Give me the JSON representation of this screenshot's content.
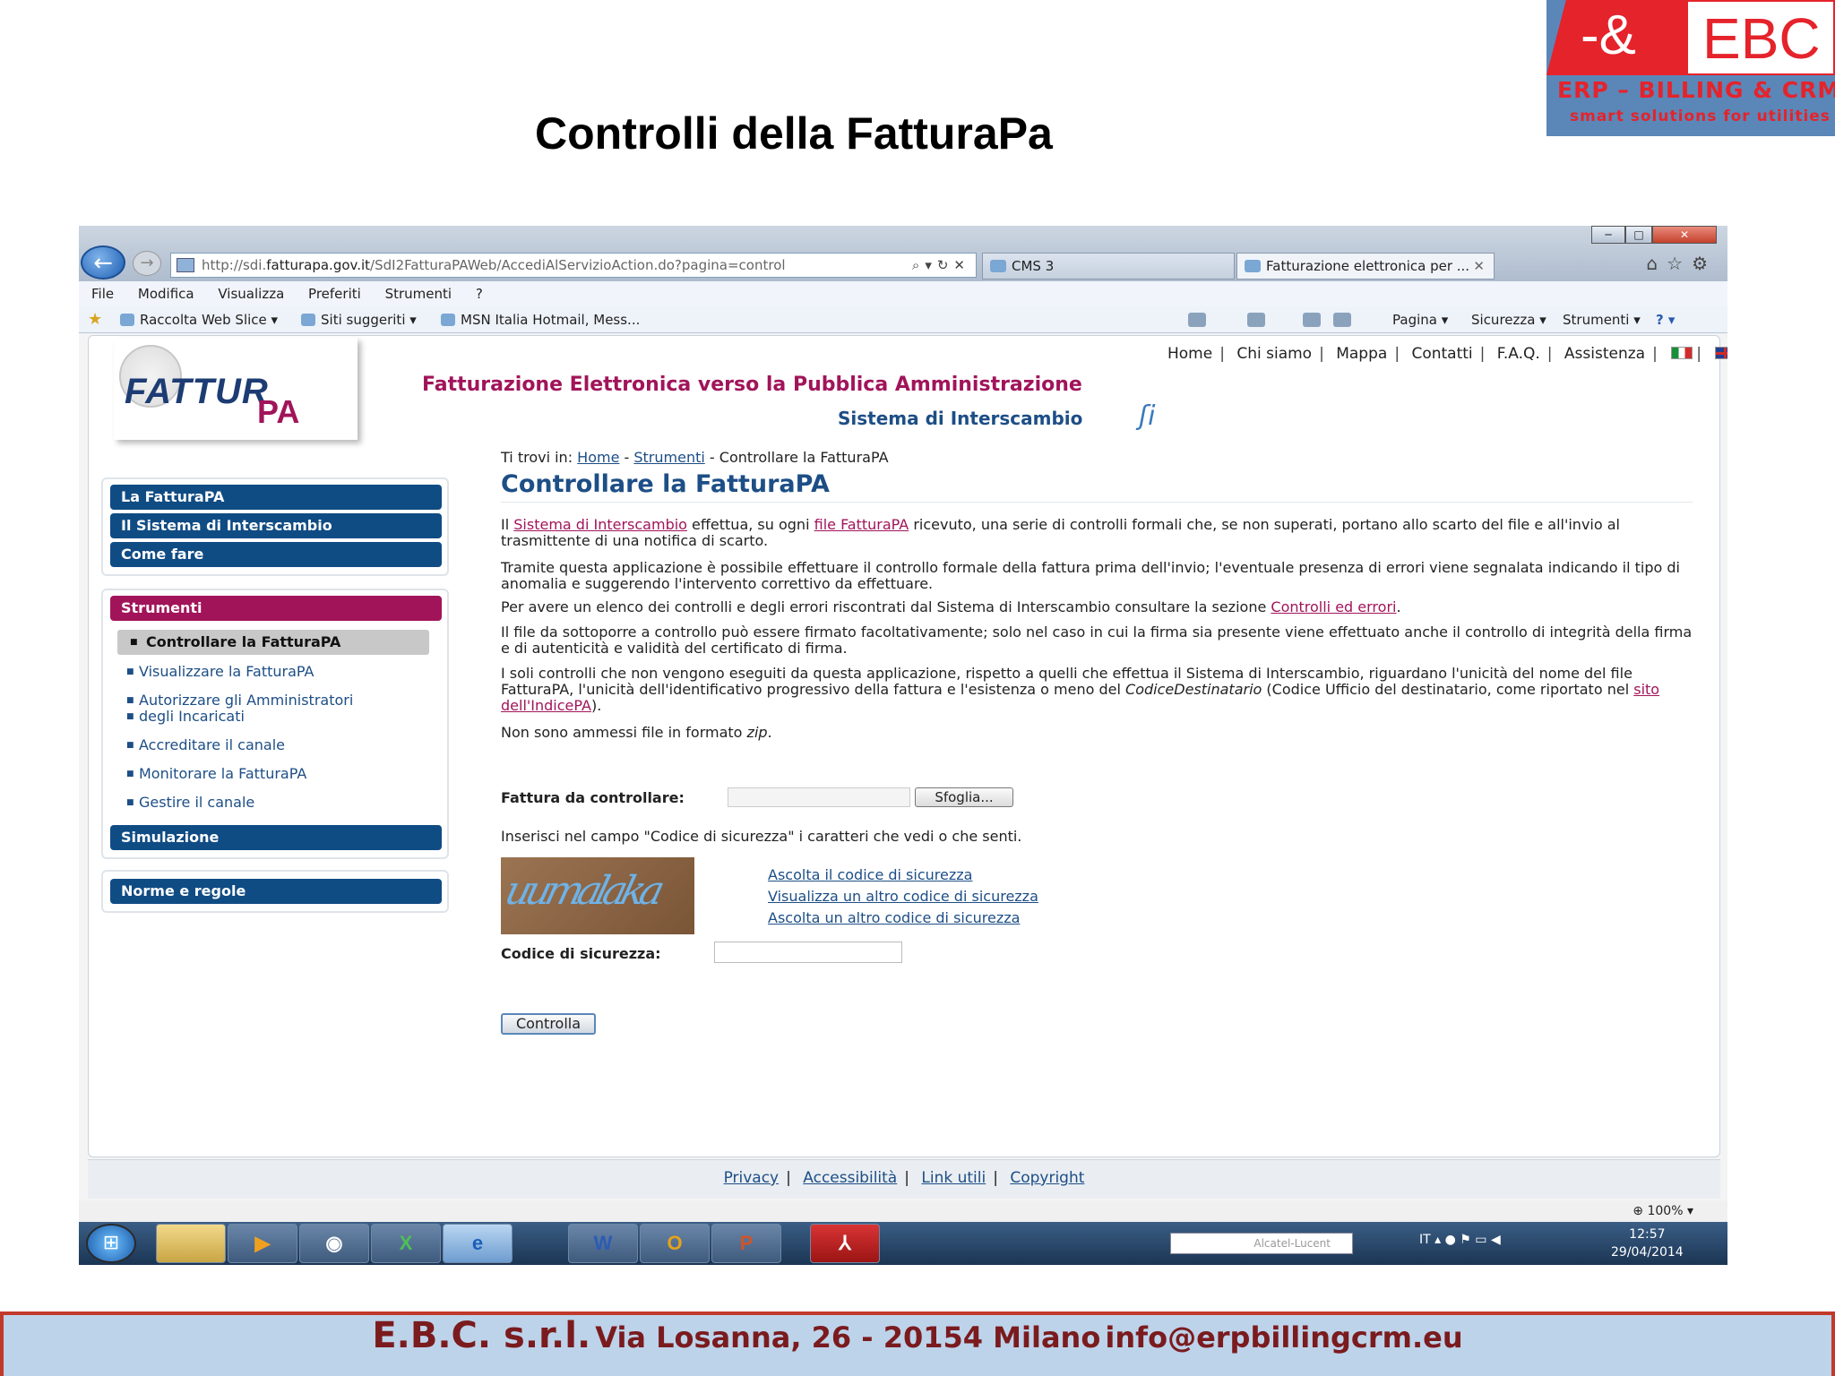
{
  "slide": {
    "title": "Controlli della FatturaPa",
    "footer_company": "E.B.C. s.r.l.",
    "footer_address": "Via Losanna, 26 - 20154 Milano",
    "footer_email": "info@erpbillingcrm.eu"
  },
  "ebc_logo": {
    "mark": "-&",
    "name": "EBC",
    "tagline": "ERP – BILLING & CRM",
    "slogan": "smart solutions for utilities",
    "colors": {
      "red": "#e5232b",
      "blue": "#5b86b8"
    }
  },
  "browser": {
    "url_prefix": "http://sdi.",
    "url_domain": "fatturapa.gov.it",
    "url_rest": "/SdI2FatturaPAWeb/AccediAlServizioAction.do?pagina=control",
    "tabs": [
      {
        "label": "CMS 3"
      },
      {
        "label": "Fatturazione elettronica per ..."
      }
    ],
    "menu": [
      "File",
      "Modifica",
      "Visualizza",
      "Preferiti",
      "Strumenti",
      "?"
    ],
    "favorites": [
      "Raccolta Web Slice",
      "Siti suggeriti",
      "MSN Italia Hotmail, Mess..."
    ],
    "commands": [
      "Pagina",
      "Sicurezza",
      "Strumenti"
    ],
    "zoom": "100%"
  },
  "site": {
    "logo_word": "FATTUR",
    "logo_a": "A",
    "logo_p": "P",
    "header_title": "Fatturazione Elettronica verso la Pubblica Amministrazione",
    "header_subtitle": "Sistema di Interscambio",
    "top_links": [
      "Home",
      "Chi siamo",
      "Mappa",
      "Contatti",
      "F.A.Q.",
      "Assistenza"
    ],
    "colors": {
      "plum": "#a1145a",
      "navy": "#104c84"
    }
  },
  "sidebar": {
    "group1": [
      "La FatturaPA",
      "Il Sistema di Interscambio",
      "Come fare"
    ],
    "strumenti_label": "Strumenti",
    "strumenti_items": [
      "Controllare la FatturaPA",
      "Visualizzare la FatturaPA",
      "Autorizzare gli Amministratori",
      "degli Incaricati",
      "Accreditare il canale",
      "Monitorare la FatturaPA",
      "Gestire il canale"
    ],
    "simulazione": "Simulazione",
    "norme": "Norme e regole"
  },
  "content": {
    "breadcrumb_prefix": "Ti trovi in:",
    "breadcrumb_home": "Home",
    "breadcrumb_strumenti": "Strumenti",
    "breadcrumb_current": "- Controllare la FatturaPA",
    "heading": "Controllare la FatturaPA",
    "p1_a": "Il",
    "p1_link1": "Sistema di Interscambio",
    "p1_b": "effettua, su ogni",
    "p1_link2": "file FatturaPA",
    "p1_c": "ricevuto, una serie di controlli formali che, se non superati, portano allo scarto del file e all'invio al trasmittente di una notifica di scarto.",
    "p2": "Tramite questa applicazione è possibile effettuare il controllo formale della fattura prima dell'invio; l'eventuale presenza di errori viene segnalata indicando il tipo di anomalia e suggerendo l'intervento correttivo da effettuare.",
    "p3_a": "Per avere un elenco dei controlli e degli errori riscontrati dal Sistema di Interscambio consultare la sezione",
    "p3_link": "Controlli ed errori",
    "p3_b": ".",
    "p4": "Il file da sottoporre a controllo può essere firmato facoltativamente; solo nel caso in cui la firma sia presente viene effettuato anche il controllo di integrità della firma e di autenticità e validità del certificato di firma.",
    "p5_a": "I soli controlli che non vengono eseguiti da questa applicazione, rispetto a quelli che effettua il Sistema di Interscambio, riguardano l'unicità del nome del file FatturaPA, l'unicità dell'identificativo progressivo della fattura e l'esistenza o meno del",
    "p5_em": "CodiceDestinatario",
    "p5_b": "(Codice Ufficio del destinatario, come riportato nel",
    "p5_link": "sito dell'IndicePA",
    "p5_c": ").",
    "p6_a": "Non sono ammessi file in formato",
    "p6_em": "zip",
    "p6_b": ".",
    "file_label": "Fattura da controllare:",
    "browse_label": "Sfoglia...",
    "captcha_hint": "Inserisci nel campo \"Codice di sicurezza\" i caratteri che vedi o che senti.",
    "captcha_text": "uumalaka",
    "captcha_links": [
      "Ascolta il codice di sicurezza",
      "Visualizza un altro codice di sicurezza",
      "Ascolta un altro codice di sicurezza"
    ],
    "code_label": "Codice di sicurezza:",
    "submit_label": "Controlla"
  },
  "page_footer": [
    "Privacy",
    "Accessibilità",
    "Link utili",
    "Copyright"
  ],
  "taskbar": {
    "search_text": "Alcatel-Lucent",
    "lang": "IT",
    "time": "12:57",
    "date": "29/04/2014",
    "apps": [
      "W",
      "O",
      "P"
    ]
  }
}
